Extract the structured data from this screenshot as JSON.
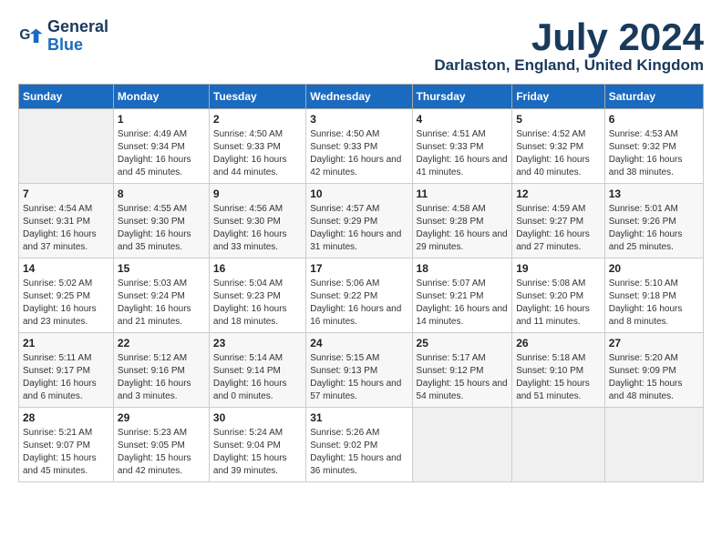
{
  "logo": {
    "line1": "General",
    "line2": "Blue"
  },
  "title": "July 2024",
  "location": "Darlaston, England, United Kingdom",
  "days_of_week": [
    "Sunday",
    "Monday",
    "Tuesday",
    "Wednesday",
    "Thursday",
    "Friday",
    "Saturday"
  ],
  "weeks": [
    [
      {
        "day": "",
        "empty": true
      },
      {
        "day": "1",
        "sunrise": "4:49 AM",
        "sunset": "9:34 PM",
        "daylight": "16 hours and 45 minutes."
      },
      {
        "day": "2",
        "sunrise": "4:50 AM",
        "sunset": "9:33 PM",
        "daylight": "16 hours and 44 minutes."
      },
      {
        "day": "3",
        "sunrise": "4:50 AM",
        "sunset": "9:33 PM",
        "daylight": "16 hours and 42 minutes."
      },
      {
        "day": "4",
        "sunrise": "4:51 AM",
        "sunset": "9:33 PM",
        "daylight": "16 hours and 41 minutes."
      },
      {
        "day": "5",
        "sunrise": "4:52 AM",
        "sunset": "9:32 PM",
        "daylight": "16 hours and 40 minutes."
      },
      {
        "day": "6",
        "sunrise": "4:53 AM",
        "sunset": "9:32 PM",
        "daylight": "16 hours and 38 minutes."
      }
    ],
    [
      {
        "day": "7",
        "sunrise": "4:54 AM",
        "sunset": "9:31 PM",
        "daylight": "16 hours and 37 minutes."
      },
      {
        "day": "8",
        "sunrise": "4:55 AM",
        "sunset": "9:30 PM",
        "daylight": "16 hours and 35 minutes."
      },
      {
        "day": "9",
        "sunrise": "4:56 AM",
        "sunset": "9:30 PM",
        "daylight": "16 hours and 33 minutes."
      },
      {
        "day": "10",
        "sunrise": "4:57 AM",
        "sunset": "9:29 PM",
        "daylight": "16 hours and 31 minutes."
      },
      {
        "day": "11",
        "sunrise": "4:58 AM",
        "sunset": "9:28 PM",
        "daylight": "16 hours and 29 minutes."
      },
      {
        "day": "12",
        "sunrise": "4:59 AM",
        "sunset": "9:27 PM",
        "daylight": "16 hours and 27 minutes."
      },
      {
        "day": "13",
        "sunrise": "5:01 AM",
        "sunset": "9:26 PM",
        "daylight": "16 hours and 25 minutes."
      }
    ],
    [
      {
        "day": "14",
        "sunrise": "5:02 AM",
        "sunset": "9:25 PM",
        "daylight": "16 hours and 23 minutes."
      },
      {
        "day": "15",
        "sunrise": "5:03 AM",
        "sunset": "9:24 PM",
        "daylight": "16 hours and 21 minutes."
      },
      {
        "day": "16",
        "sunrise": "5:04 AM",
        "sunset": "9:23 PM",
        "daylight": "16 hours and 18 minutes."
      },
      {
        "day": "17",
        "sunrise": "5:06 AM",
        "sunset": "9:22 PM",
        "daylight": "16 hours and 16 minutes."
      },
      {
        "day": "18",
        "sunrise": "5:07 AM",
        "sunset": "9:21 PM",
        "daylight": "16 hours and 14 minutes."
      },
      {
        "day": "19",
        "sunrise": "5:08 AM",
        "sunset": "9:20 PM",
        "daylight": "16 hours and 11 minutes."
      },
      {
        "day": "20",
        "sunrise": "5:10 AM",
        "sunset": "9:18 PM",
        "daylight": "16 hours and 8 minutes."
      }
    ],
    [
      {
        "day": "21",
        "sunrise": "5:11 AM",
        "sunset": "9:17 PM",
        "daylight": "16 hours and 6 minutes."
      },
      {
        "day": "22",
        "sunrise": "5:12 AM",
        "sunset": "9:16 PM",
        "daylight": "16 hours and 3 minutes."
      },
      {
        "day": "23",
        "sunrise": "5:14 AM",
        "sunset": "9:14 PM",
        "daylight": "16 hours and 0 minutes."
      },
      {
        "day": "24",
        "sunrise": "5:15 AM",
        "sunset": "9:13 PM",
        "daylight": "15 hours and 57 minutes."
      },
      {
        "day": "25",
        "sunrise": "5:17 AM",
        "sunset": "9:12 PM",
        "daylight": "15 hours and 54 minutes."
      },
      {
        "day": "26",
        "sunrise": "5:18 AM",
        "sunset": "9:10 PM",
        "daylight": "15 hours and 51 minutes."
      },
      {
        "day": "27",
        "sunrise": "5:20 AM",
        "sunset": "9:09 PM",
        "daylight": "15 hours and 48 minutes."
      }
    ],
    [
      {
        "day": "28",
        "sunrise": "5:21 AM",
        "sunset": "9:07 PM",
        "daylight": "15 hours and 45 minutes."
      },
      {
        "day": "29",
        "sunrise": "5:23 AM",
        "sunset": "9:05 PM",
        "daylight": "15 hours and 42 minutes."
      },
      {
        "day": "30",
        "sunrise": "5:24 AM",
        "sunset": "9:04 PM",
        "daylight": "15 hours and 39 minutes."
      },
      {
        "day": "31",
        "sunrise": "5:26 AM",
        "sunset": "9:02 PM",
        "daylight": "15 hours and 36 minutes."
      },
      {
        "day": "",
        "empty": true
      },
      {
        "day": "",
        "empty": true
      },
      {
        "day": "",
        "empty": true
      }
    ]
  ]
}
